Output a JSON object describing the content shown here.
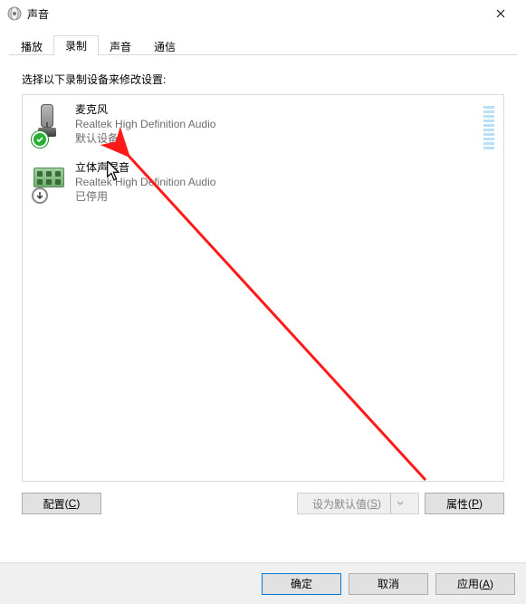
{
  "window": {
    "title": "声音"
  },
  "tabs": [
    "播放",
    "录制",
    "声音",
    "通信"
  ],
  "active_tab_index": 1,
  "panel": {
    "instruction": "选择以下录制设备来修改设置:",
    "devices": [
      {
        "name": "麦克风",
        "desc": "Realtek High Definition Audio",
        "status": "默认设备",
        "badge": "check",
        "show_meter": true
      },
      {
        "name": "立体声混音",
        "desc": "Realtek High Definition Audio",
        "status": "已停用",
        "badge": "down",
        "show_meter": false
      }
    ],
    "configure_button": {
      "text": "配置",
      "hotkey": "C"
    },
    "default_button": {
      "text": "设为默认值",
      "hotkey": "S",
      "disabled": true
    },
    "properties_button": {
      "text": "属性",
      "hotkey": "P"
    }
  },
  "footer": {
    "ok": "确定",
    "cancel": "取消",
    "apply": {
      "text": "应用",
      "hotkey": "A"
    }
  }
}
